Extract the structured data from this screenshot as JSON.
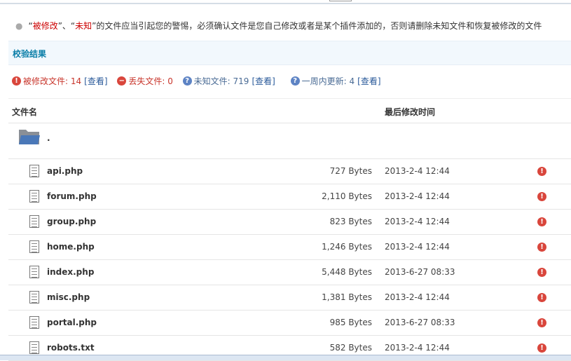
{
  "tip": {
    "q1": "“",
    "modified": "被修改",
    "q2": "”、“",
    "unknown": "未知",
    "rest": "”的文件应当引起您的警惕，必须确认文件是您自己修改或者是某个插件添加的，否则请删除未知文件和恢复被修改的文件"
  },
  "section_title": "校验结果",
  "stats": [
    {
      "label": "被修改文件: 14",
      "link": "[查看]",
      "icon": "error-icon"
    },
    {
      "label": "丢失文件: 0",
      "link": "",
      "icon": "minus-icon"
    },
    {
      "label": "未知文件: 719",
      "link": "[查看]",
      "icon": "question-icon"
    },
    {
      "label": "一周内更新: 4",
      "link": "[查看]",
      "icon": "question-icon"
    }
  ],
  "columns": {
    "name": "文件名",
    "mtime": "最后修改时间"
  },
  "folder": {
    "name": "."
  },
  "files": [
    {
      "name": "api.php",
      "size": "727 Bytes",
      "time": "2013-2-4 12:44"
    },
    {
      "name": "forum.php",
      "size": "2,110 Bytes",
      "time": "2013-2-4 12:44"
    },
    {
      "name": "group.php",
      "size": "823 Bytes",
      "time": "2013-2-4 12:44"
    },
    {
      "name": "home.php",
      "size": "1,246 Bytes",
      "time": "2013-2-4 12:44"
    },
    {
      "name": "index.php",
      "size": "5,448 Bytes",
      "time": "2013-6-27 08:33"
    },
    {
      "name": "misc.php",
      "size": "1,381 Bytes",
      "time": "2013-2-4 12:44"
    },
    {
      "name": "portal.php",
      "size": "985 Bytes",
      "time": "2013-6-27 08:33"
    },
    {
      "name": "robots.txt",
      "size": "582 Bytes",
      "time": "2013-2-4 12:44"
    }
  ]
}
